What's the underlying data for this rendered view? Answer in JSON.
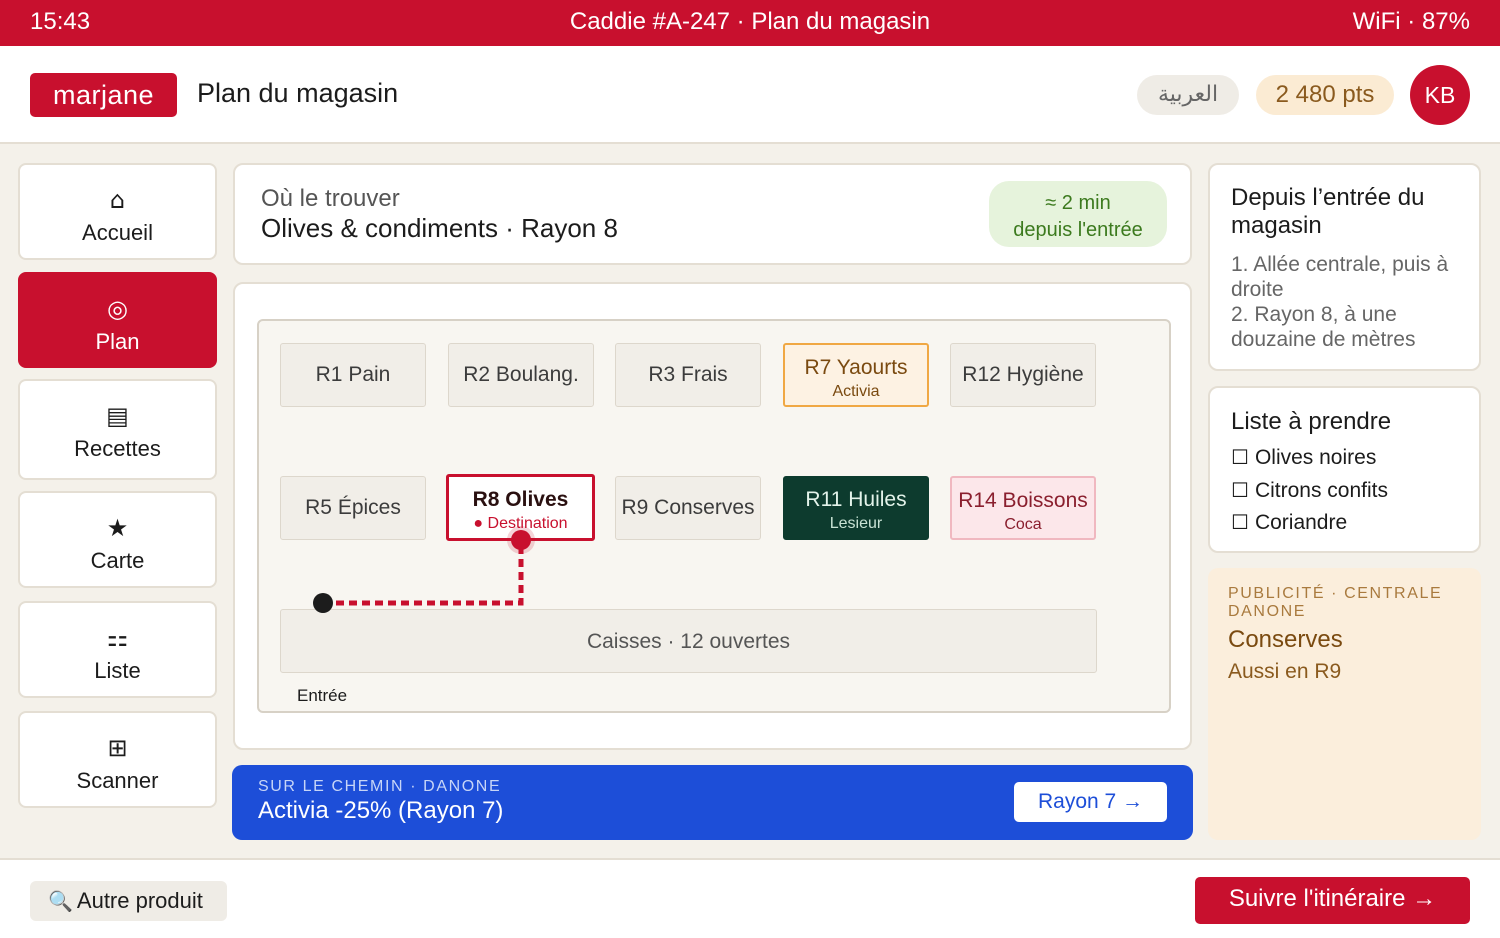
{
  "status": {
    "time": "15:43",
    "title": "Caddie #A-247 · Plan du magasin",
    "wifi": "WiFi · 87%"
  },
  "header": {
    "logo": "marjane",
    "page_title": "Plan du magasin",
    "lang": "العربية",
    "points": "2 480 pts",
    "avatar": "KB"
  },
  "nav": [
    {
      "icon": "⌂",
      "label": "Accueil"
    },
    {
      "icon": "◎",
      "label": "Plan"
    },
    {
      "icon": "▤",
      "label": "Recettes"
    },
    {
      "icon": "★",
      "label": "Carte"
    },
    {
      "icon": "⚏",
      "label": "Liste"
    },
    {
      "icon": "⊞",
      "label": "Scanner"
    }
  ],
  "find": {
    "kicker": "Où le trouver",
    "title": "Olives & condiments · Rayon 8",
    "eta_line1": "≈ 2 min",
    "eta_line2": "depuis l'entrée"
  },
  "map": {
    "aisles": [
      {
        "name": "R1 Pain",
        "sub": ""
      },
      {
        "name": "R2 Boulang.",
        "sub": ""
      },
      {
        "name": "R3 Frais",
        "sub": ""
      },
      {
        "name": "R7 Yaourts",
        "sub": "Activia"
      },
      {
        "name": "R12 Hygiène",
        "sub": ""
      },
      {
        "name": "R5 Épices",
        "sub": ""
      },
      {
        "name": "R8 Olives",
        "sub": "● Destination"
      },
      {
        "name": "R9 Conserves",
        "sub": ""
      },
      {
        "name": "R11 Huiles",
        "sub": "Lesieur"
      },
      {
        "name": "R14 Boissons",
        "sub": "Coca"
      }
    ],
    "checkout": "Caisses · 12 ouvertes",
    "entrance": "Entrée",
    "colors": {
      "route": "#c8102e",
      "accent": "#c8102e",
      "featured": "#f0a844",
      "dark": "#0d3b2e"
    }
  },
  "promo": {
    "kicker": "SUR LE CHEMIN · DANONE",
    "title": "Activia -25% (Rayon 7)",
    "button": "Rayon 7 →",
    "color": "#1d4ed8"
  },
  "directions": {
    "title": "Depuis l’entrée du magasin",
    "steps": [
      "1. Allée centrale, puis à droite",
      "2. Rayon 8, à une douzaine de mètres"
    ]
  },
  "shopping_list": {
    "title": "Liste à prendre",
    "items": [
      "Olives noires",
      "Citrons confits",
      "Coriandre"
    ],
    "checkbox": "☐"
  },
  "ad": {
    "kicker": "PUBLICITÉ · CENTRALE DANONE",
    "title": "Conserves",
    "sub": "Aussi en R9"
  },
  "footer": {
    "search_icon": "🔍",
    "other_label": "Autre produit",
    "follow_label": "Suivre l'itinéraire →"
  }
}
